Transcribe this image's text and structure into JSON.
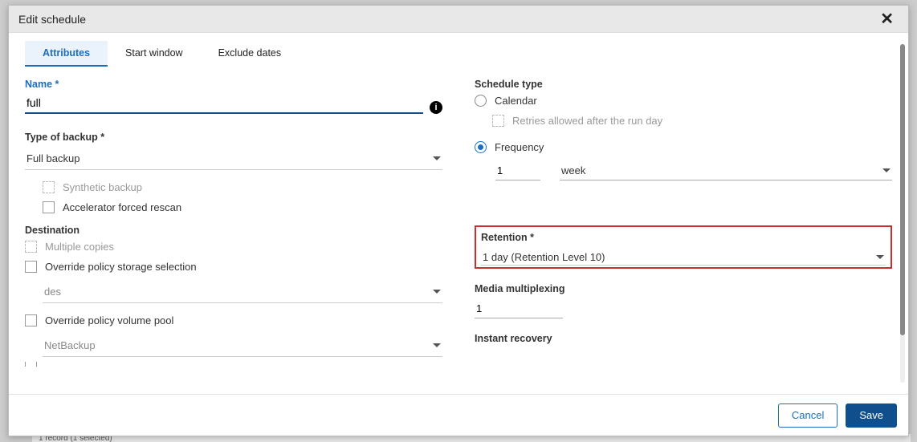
{
  "dialog": {
    "title": "Edit schedule"
  },
  "tabs": {
    "attributes": "Attributes",
    "start_window": "Start window",
    "exclude_dates": "Exclude dates"
  },
  "left": {
    "name_label": "Name *",
    "name_value": "full",
    "type_label": "Type of backup *",
    "type_value": "Full backup",
    "synthetic_label": "Synthetic backup",
    "accel_label": "Accelerator forced rescan",
    "destination_label": "Destination",
    "multiple_copies_label": "Multiple copies",
    "override_storage_label": "Override policy storage selection",
    "storage_value": "des",
    "override_volume_label": "Override policy volume pool",
    "volume_value": "NetBackup"
  },
  "right": {
    "schedule_type_label": "Schedule type",
    "calendar_label": "Calendar",
    "retries_label": "Retries allowed after the run day",
    "frequency_label": "Frequency",
    "frequency_value": "1",
    "frequency_unit": "week",
    "retention_label": "Retention *",
    "retention_value": "1 day (Retention Level 10)",
    "media_multiplexing_label": "Media multiplexing",
    "media_multiplexing_value": "1",
    "instant_recovery_label": "Instant recovery"
  },
  "footer": {
    "cancel": "Cancel",
    "save": "Save"
  },
  "behind": {
    "record_text": "1 record (1 selected)"
  }
}
